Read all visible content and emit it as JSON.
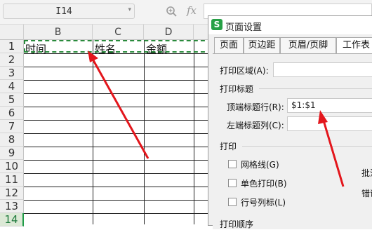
{
  "formula_bar": {
    "name_box": "I14",
    "fx_label": "fx"
  },
  "sheet": {
    "columns": [
      "B",
      "C",
      "D"
    ],
    "rows": [
      "1",
      "2",
      "3",
      "4",
      "5",
      "6",
      "7",
      "8",
      "9",
      "10",
      "11",
      "12",
      "13",
      "14",
      "15"
    ],
    "header_cells": [
      "时间",
      "姓名",
      "金额"
    ]
  },
  "dialog": {
    "title": "页面设置",
    "logo": "S",
    "tabs": [
      "页面",
      "页边距",
      "页眉/页脚",
      "工作表"
    ],
    "print_area_label": "打印区域(A):",
    "print_titles_section": "打印标题",
    "top_rows_label": "顶端标题行(R):",
    "top_rows_value": "$1:$1",
    "left_cols_label": "左端标题列(C):",
    "print_section": "打印",
    "gridlines_label": "网格线(G)",
    "monochrome_label": "单色打印(B)",
    "row_col_headers_label": "行号列标(L)",
    "print_order_section": "打印顺序",
    "right_partial_1": "批注",
    "right_partial_2": "错误"
  },
  "colors": {
    "marquee": "#2a8a3c",
    "arrow": "#e3161c",
    "active_row": "#1f9c48"
  }
}
